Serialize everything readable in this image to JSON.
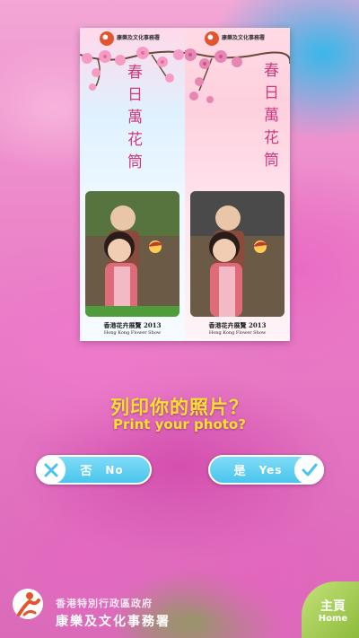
{
  "preview": {
    "panels": [
      {
        "dept_name": "康樂及文化事務署",
        "title": "春日萬花筒",
        "footer_zh": "香港花卉展覽 2013",
        "footer_en": "Hong Kong Flower Show"
      },
      {
        "dept_name": "康樂及文化事務署",
        "title": "春日萬花筒",
        "footer_zh": "香港花卉展覽 2013",
        "footer_en": "Hong Kong Flower Show"
      }
    ]
  },
  "prompt": {
    "zh": "列印你的照片？",
    "en": "Print your photo?"
  },
  "buttons": {
    "no_zh": "否",
    "no_en": "No",
    "yes_zh": "是",
    "yes_en": "Yes"
  },
  "footer": {
    "dept_line1": "香港特別行政區政府",
    "dept_line2": "康樂及文化事務署"
  },
  "home": {
    "zh": "主頁",
    "en": "Home"
  },
  "colors": {
    "prompt": "#ffe12d",
    "button": "#4bc4ec",
    "home": "#8dbb3c"
  }
}
